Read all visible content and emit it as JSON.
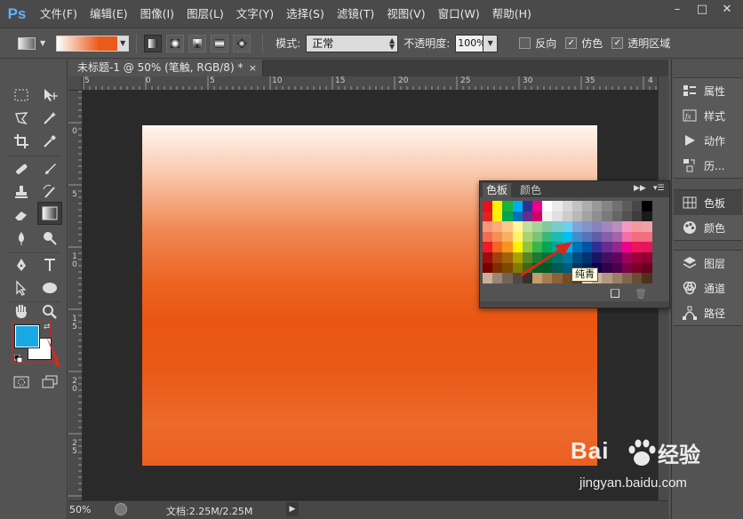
{
  "app": {
    "logo": "Ps",
    "menu": [
      "文件(F)",
      "编辑(E)",
      "图像(I)",
      "图层(L)",
      "文字(Y)",
      "选择(S)",
      "滤镜(T)",
      "视图(V)",
      "窗口(W)",
      "帮助(H)"
    ],
    "window_controls": [
      "–",
      "□",
      "✕"
    ]
  },
  "options_bar": {
    "mode_label": "模式:",
    "mode_value": "正常",
    "opacity_label": "不透明度:",
    "opacity_value": "100%",
    "checkboxes": [
      {
        "label": "反向",
        "checked": false
      },
      {
        "label": "仿色",
        "checked": true
      },
      {
        "label": "透明区域",
        "checked": true
      }
    ],
    "gradient_colors": [
      "#ffffff",
      "#ea5a1a"
    ]
  },
  "document": {
    "tab_title": "未标题-1 @ 50% (笔触, RGB/8) *",
    "tab_close": "×",
    "ruler_h_labels": [
      "5",
      "0",
      "5",
      "10",
      "15",
      "20",
      "25",
      "30",
      "35",
      "4"
    ],
    "ruler_v_labels": [
      "0",
      "5",
      "10",
      "15",
      "20",
      "25"
    ]
  },
  "status_bar": {
    "zoom": "50%",
    "doc_size": "文档:2.25M/2.25M",
    "arrow": "▶"
  },
  "tools": {
    "foreground_color": "#18a8e4",
    "background_color": "#ffffff"
  },
  "right_dock": {
    "group1": [
      {
        "label": "属性",
        "icon": "properties-icon"
      },
      {
        "label": "样式",
        "icon": "styles-icon"
      },
      {
        "label": "动作",
        "icon": "actions-icon"
      },
      {
        "label": "历...",
        "icon": "history-icon"
      }
    ],
    "group2": [
      {
        "label": "色板",
        "icon": "swatches-icon"
      },
      {
        "label": "颜色",
        "icon": "color-icon"
      }
    ],
    "group3": [
      {
        "label": "图层",
        "icon": "layers-icon"
      },
      {
        "label": "通道",
        "icon": "channels-icon"
      },
      {
        "label": "路径",
        "icon": "paths-icon"
      }
    ]
  },
  "swatch_panel": {
    "tabs": [
      "色板",
      "颜色"
    ],
    "tooltip": "纯青",
    "rows": [
      [
        "#e8101a",
        "#fff200",
        "#19b23b",
        "#00aeef",
        "#2e3192",
        "#ec008c",
        "#ffffff",
        "#ebebeb",
        "#d7d7d7",
        "#c2c2c2",
        "#adadad",
        "#999999",
        "#858585",
        "#707070",
        "#5c5c5c",
        "#474747",
        "#000000"
      ],
      [
        "#e41f26",
        "#fef200",
        "#00a650",
        "#0072bc",
        "#662d91",
        "#cf006a",
        "#f2f2f2",
        "#e0e0e0",
        "#cccccc",
        "#b8b8b8",
        "#a3a3a3",
        "#8f8f8f",
        "#7a7a7a",
        "#666666",
        "#525252",
        "#3d3d3d",
        "#1a1a1a"
      ],
      [
        "#f7977a",
        "#f9ad81",
        "#fdc68a",
        "#fff79a",
        "#c4df9b",
        "#a2d39c",
        "#82ca9d",
        "#7bcdc8",
        "#6ecff6",
        "#7ea7d8",
        "#8493ca",
        "#8882be",
        "#a187be",
        "#bc8dbf",
        "#f49ac2",
        "#f6989d",
        "#f1a1a5"
      ],
      [
        "#f26c4f",
        "#f68e55",
        "#fbaf5c",
        "#fff467",
        "#acd372",
        "#7cc576",
        "#3bb878",
        "#1abbb4",
        "#00bff3",
        "#438ccb",
        "#5574b9",
        "#605ca8",
        "#855fa8",
        "#a763a8",
        "#f06ea9",
        "#f26d7d",
        "#f07080"
      ],
      [
        "#ed1c24",
        "#f26522",
        "#f7941d",
        "#fff200",
        "#8dc63f",
        "#39b54a",
        "#00a651",
        "#00a99d",
        "#00aeef",
        "#0072bc",
        "#0054a6",
        "#2e3192",
        "#662d91",
        "#92278f",
        "#ec008c",
        "#ed145b",
        "#e8145a"
      ],
      [
        "#9e0b0f",
        "#a0410d",
        "#a36209",
        "#aba000",
        "#598527",
        "#197b30",
        "#007236",
        "#00746b",
        "#0076a3",
        "#004b80",
        "#003471",
        "#1b1464",
        "#440e62",
        "#630460",
        "#9e005d",
        "#9e0039",
        "#8f0035"
      ],
      [
        "#790000",
        "#7b2e00",
        "#7d4900",
        "#827b00",
        "#406618",
        "#005e20",
        "#005826",
        "#005952",
        "#005b7f",
        "#003663",
        "#002157",
        "#0d004c",
        "#32004b",
        "#4b0049",
        "#7b0046",
        "#7a0026",
        "#6a0020"
      ],
      [
        "#c7b299",
        "#998675",
        "#736357",
        "#534741",
        "#37302d",
        "#c69c6d",
        "#a67c52",
        "#8c6239",
        "#754c24",
        "#603913",
        "#e8d5c0",
        "#cdb497",
        "#b39a7f",
        "#9a8066",
        "#7f664d",
        "#664d33",
        "#4d331a"
      ]
    ]
  },
  "watermark": {
    "brand": "Bai",
    "brand_cn": "经验",
    "url": "jingyan.baidu.com"
  }
}
